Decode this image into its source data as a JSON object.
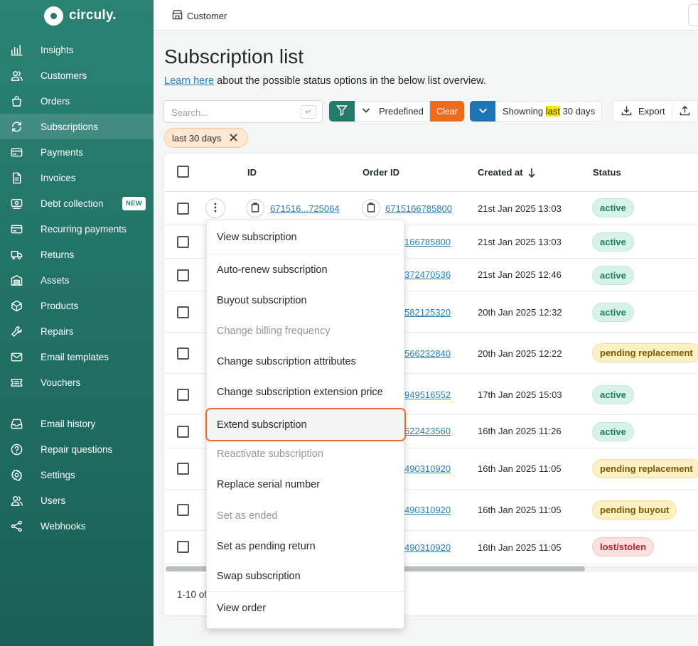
{
  "app": {
    "brand": "circuly."
  },
  "sidebar": {
    "items": [
      {
        "label": "Insights",
        "icon": "bar-chart-icon"
      },
      {
        "label": "Customers",
        "icon": "users-icon"
      },
      {
        "label": "Orders",
        "icon": "shopping-bag-icon"
      },
      {
        "label": "Subscriptions",
        "icon": "refresh-icon",
        "active": true
      },
      {
        "label": "Payments",
        "icon": "credit-card-icon"
      },
      {
        "label": "Invoices",
        "icon": "document-icon"
      },
      {
        "label": "Debt collection",
        "icon": "money-icon",
        "badge": "NEW"
      },
      {
        "label": "Recurring payments",
        "icon": "credit-card-icon"
      },
      {
        "label": "Returns",
        "icon": "truck-icon"
      },
      {
        "label": "Assets",
        "icon": "warehouse-icon"
      },
      {
        "label": "Products",
        "icon": "box-icon"
      },
      {
        "label": "Repairs",
        "icon": "wrench-icon"
      },
      {
        "label": "Email templates",
        "icon": "mail-icon"
      },
      {
        "label": "Vouchers",
        "icon": "ticket-icon"
      },
      {
        "label": "Email history",
        "icon": "inbox-icon"
      },
      {
        "label": "Repair questions",
        "icon": "question-icon"
      },
      {
        "label": "Settings",
        "icon": "gear-icon"
      },
      {
        "label": "Users",
        "icon": "users-icon"
      },
      {
        "label": "Webhooks",
        "icon": "share-icon"
      }
    ]
  },
  "topbar": {
    "breadcrumb": "Customer"
  },
  "page": {
    "title": "Subscription list",
    "learn_link": "Learn here",
    "learn_text": " about the possible status options in the below list overview."
  },
  "toolbar": {
    "search_placeholder": "Search...",
    "enter_symbol": "↵",
    "predefined_label": "Predefined",
    "clear_label": "Clear",
    "range_prefix": "Showning ",
    "range_highlight": "last",
    "range_suffix": " 30 days",
    "export_label": "Export"
  },
  "filter_chip": {
    "label": "last 30 days"
  },
  "table": {
    "headers": {
      "id": "ID",
      "order_id": "Order ID",
      "created_at": "Created at",
      "status": "Status"
    },
    "rows": [
      {
        "id": "671516...725064",
        "order_id": "6715166785800",
        "created_at": "21st Jan 2025 13:03",
        "status": "active"
      },
      {
        "id": "",
        "order_id": "166785800",
        "created_at": "21st Jan 2025 13:03",
        "status": "active"
      },
      {
        "id": "",
        "order_id": "372470536",
        "created_at": "21st Jan 2025 12:46",
        "status": "active"
      },
      {
        "id": "",
        "order_id": "582125320",
        "created_at": "20th Jan 2025 12:32",
        "status": "active"
      },
      {
        "id": "",
        "order_id": "566232840",
        "created_at": "20th Jan 2025 12:22",
        "status": "pending replacement"
      },
      {
        "id": "",
        "order_id": "949516552",
        "created_at": "17th Jan 2025 15:03",
        "status": "active"
      },
      {
        "id": "",
        "order_id": "522423560",
        "created_at": "16th Jan 2025 11:26",
        "status": "active"
      },
      {
        "id": "",
        "order_id": "490310920",
        "created_at": "16th Jan 2025 11:05",
        "status": "pending replacement"
      },
      {
        "id": "",
        "order_id": "490310920",
        "created_at": "16th Jan 2025 11:05",
        "status": "pending buyout"
      },
      {
        "id": "",
        "order_id": "490310920",
        "created_at": "16th Jan 2025 11:05",
        "status": "lost/stolen"
      }
    ],
    "pagination": "1-10 of"
  },
  "context_menu": {
    "items": [
      {
        "label": "View subscription",
        "disabled": false
      },
      {
        "label": "Auto-renew subscription",
        "disabled": false
      },
      {
        "label": "Buyout subscription",
        "disabled": false
      },
      {
        "label": "Change billing frequency",
        "disabled": true
      },
      {
        "label": "Change subscription attributes",
        "disabled": false
      },
      {
        "label": "Change subscription extension price",
        "disabled": false
      },
      {
        "label": "Extend subscription",
        "disabled": false,
        "highlighted": true
      },
      {
        "label": "Reactivate subscription",
        "disabled": true
      },
      {
        "label": "Replace serial number",
        "disabled": false
      },
      {
        "label": "Set as ended",
        "disabled": true
      },
      {
        "label": "Set as pending return",
        "disabled": false
      },
      {
        "label": "Swap subscription",
        "disabled": false
      },
      {
        "label": "View order",
        "disabled": false
      }
    ]
  },
  "colors": {
    "sidebar": "#257a6c",
    "primary_green": "#257a6c",
    "clear_orange": "#f06a1d",
    "range_blue": "#1e75b6",
    "highlight_outline": "#f06a38",
    "link": "#2a7fb8"
  }
}
